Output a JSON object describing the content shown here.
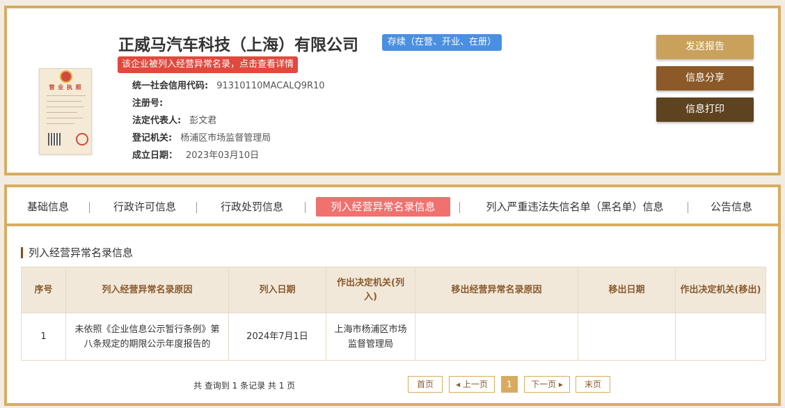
{
  "company": {
    "name": "正威马汽车科技（上海）有限公司",
    "status": "存续（在营、开业、在册）",
    "abnormal_notice": "该企业被列入经营异常名录，点击查看详情",
    "license_title": "营 业 执 照"
  },
  "info": [
    {
      "label": "统一社会信用代码:",
      "value": "91310110MACALQ9R10"
    },
    {
      "label": "注册号:",
      "value": ""
    },
    {
      "label": "法定代表人:",
      "value": "彭文君"
    },
    {
      "label": "登记机关:",
      "value": "杨浦区市场监督管理局"
    },
    {
      "label": "成立日期：",
      "value": "2023年03月10日"
    }
  ],
  "actions": {
    "send_report": "发送报告",
    "share": "信息分享",
    "print": "信息打印"
  },
  "colors": {
    "send_report": "#c9a15b",
    "share": "#8b5a28",
    "print": "#5e4320"
  },
  "tabs": [
    {
      "label": "基础信息"
    },
    {
      "label": "行政许可信息"
    },
    {
      "label": "行政处罚信息"
    },
    {
      "label": "列入经营异常名录信息"
    },
    {
      "label": "列入严重违法失信名单（黑名单）信息"
    },
    {
      "label": "公告信息"
    }
  ],
  "section": {
    "title": "列入经营异常名录信息"
  },
  "table": {
    "headers": [
      "序号",
      "列入经营异常名录原因",
      "列入日期",
      "作出决定机关(列入)",
      "移出经营异常名录原因",
      "移出日期",
      "作出决定机关(移出)"
    ],
    "rows": [
      [
        "1",
        "未依照《企业信息公示暂行条例》第八条规定的期限公示年度报告的",
        "2024年7月1日",
        "上海市杨浦区市场监督管理局",
        "",
        "",
        ""
      ]
    ]
  },
  "pager": {
    "summary": "共 查询到 1 条记录 共 1 页",
    "first": "首页",
    "prev": "上一页",
    "current": "1",
    "next": "下一页",
    "last": "末页"
  }
}
